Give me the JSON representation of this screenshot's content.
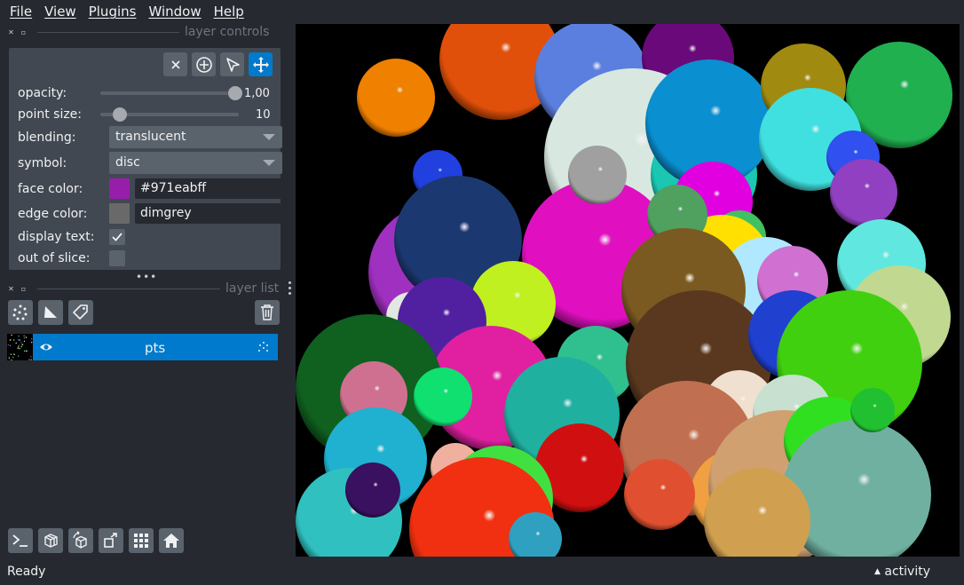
{
  "menu": [
    "File",
    "View",
    "Plugins",
    "Window",
    "Help"
  ],
  "layer_controls": {
    "title": "layer controls",
    "opacity": {
      "label": "opacity:",
      "value": "1,00",
      "fraction": 1.0
    },
    "point_size": {
      "label": "point size:",
      "value": "10",
      "fraction": 0.1
    },
    "blending": {
      "label": "blending:",
      "value": "translucent"
    },
    "symbol": {
      "label": "symbol:",
      "value": "disc"
    },
    "face_color": {
      "label": "face color:",
      "value": "#971eabff",
      "swatch": "#971eab"
    },
    "edge_color": {
      "label": "edge color:",
      "value": "dimgrey",
      "swatch": "#696969"
    },
    "display_text": {
      "label": "display text:",
      "checked": true
    },
    "out_of_slice": {
      "label": "out of slice:",
      "checked": false
    }
  },
  "layer_list": {
    "title": "layer list",
    "layers": [
      {
        "name": "pts",
        "visible": true
      }
    ]
  },
  "status": {
    "text": "Ready",
    "activity": "activity"
  },
  "colors": {
    "accent": "#007acc",
    "panel": "#414851",
    "background": "#262930",
    "button": "#5a626c"
  }
}
